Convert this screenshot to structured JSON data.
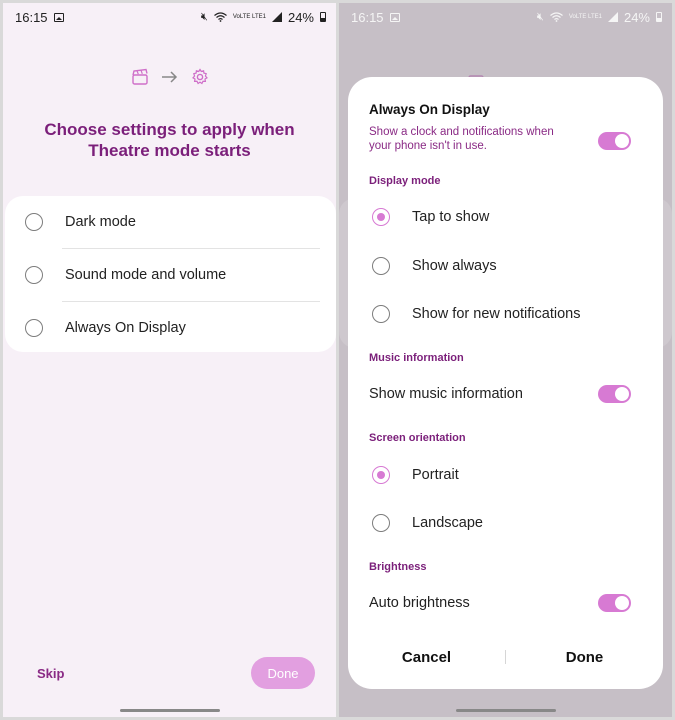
{
  "status_bar": {
    "time": "16:15",
    "battery": "24%",
    "network_label": "VoLTE LTE1"
  },
  "left_screen": {
    "headline": "Choose settings to apply when Theatre mode starts",
    "top_icons": [
      "clapperboard-icon",
      "arrow-right-icon",
      "gear-icon"
    ],
    "options": [
      {
        "label": "Dark mode",
        "checked": false
      },
      {
        "label": "Sound mode and volume",
        "checked": false
      },
      {
        "label": "Always On Display",
        "checked": false
      }
    ],
    "skip_label": "Skip",
    "done_label": "Done"
  },
  "dialog": {
    "title": "Always On Display",
    "description": "Show a clock and notifications when your phone isn't in use.",
    "main_toggle_on": true,
    "display_mode": {
      "header": "Display mode",
      "options": [
        {
          "label": "Tap to show",
          "selected": true
        },
        {
          "label": "Show always",
          "selected": false
        },
        {
          "label": "Show for new notifications",
          "selected": false
        }
      ]
    },
    "music": {
      "header": "Music information",
      "toggle_label": "Show music information",
      "toggle_on": true
    },
    "orientation": {
      "header": "Screen orientation",
      "options": [
        {
          "label": "Portrait",
          "selected": true
        },
        {
          "label": "Landscape",
          "selected": false
        }
      ]
    },
    "brightness": {
      "header": "Brightness",
      "toggle_label": "Auto brightness",
      "toggle_on": true
    },
    "cancel_label": "Cancel",
    "done_label": "Done"
  },
  "colors": {
    "accent": "#d77ad3",
    "headline": "#7b1f7a",
    "done_pill": "#e29fe0"
  }
}
